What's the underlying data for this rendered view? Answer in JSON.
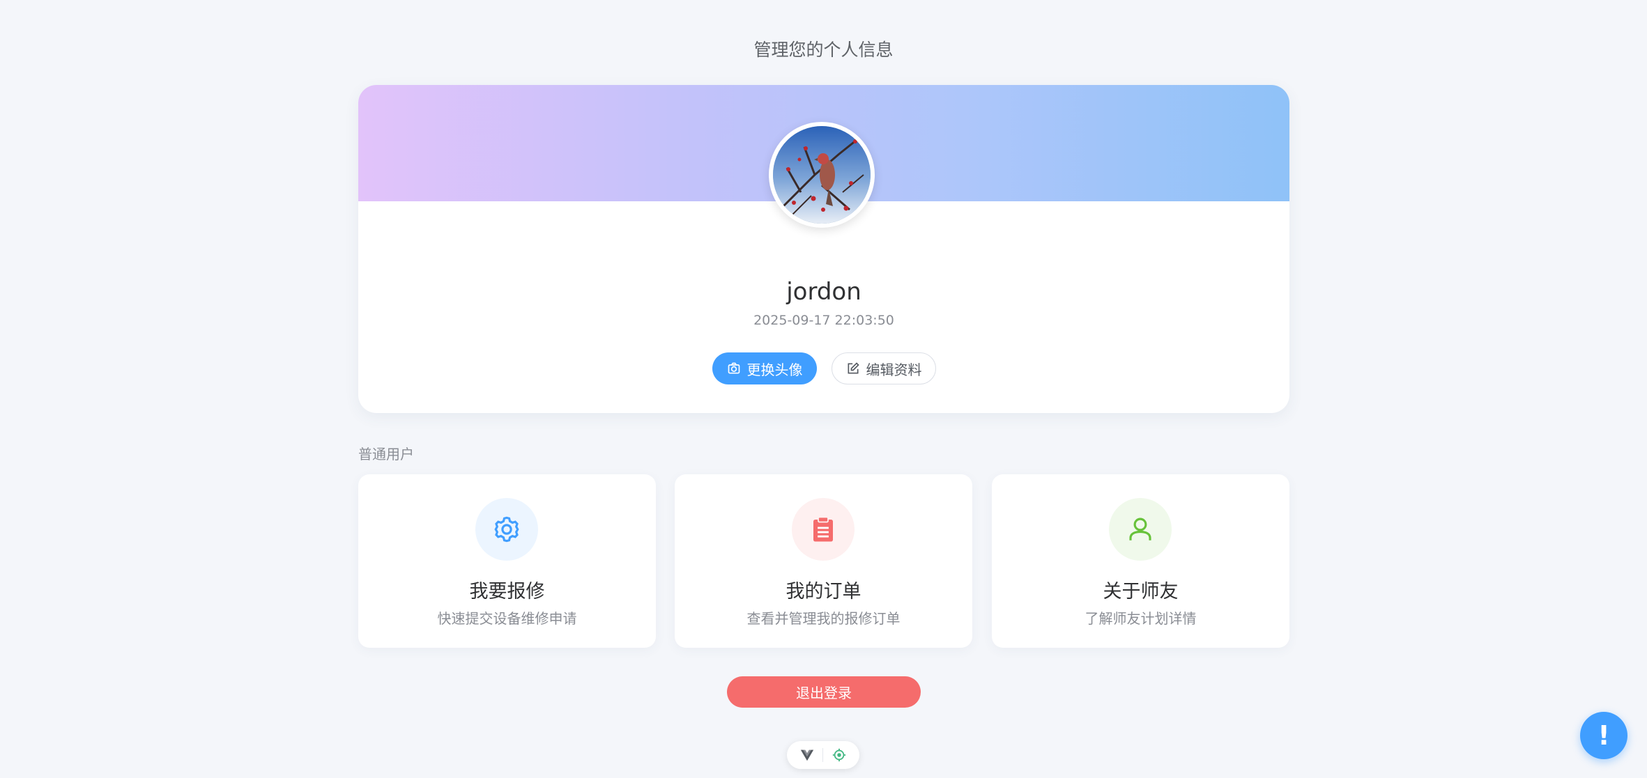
{
  "header": {
    "subtitle": "管理您的个人信息"
  },
  "profile": {
    "username": "jordon",
    "joined": "2025-09-17 22:03:50",
    "change_avatar_label": "更换头像",
    "edit_profile_label": "编辑资料",
    "banner_colors": [
      "#e2c3fa",
      "#8fc2f8"
    ]
  },
  "section": {
    "label": "普通用户"
  },
  "features": [
    {
      "title": "我要报修",
      "desc": "快速提交设备维修申请",
      "icon": "gear-icon",
      "color": "#409eff"
    },
    {
      "title": "我的订单",
      "desc": "查看并管理我的报修订单",
      "icon": "clipboard-icon",
      "color": "#f56c6c"
    },
    {
      "title": "关于师友",
      "desc": "了解师友计划详情",
      "icon": "user-icon",
      "color": "#67c23a"
    }
  ],
  "logout": {
    "label": "退出登录"
  },
  "help": {
    "symbol": "!"
  },
  "colors": {
    "primary": "#409eff",
    "danger": "#f56c6c",
    "success": "#67c23a"
  }
}
